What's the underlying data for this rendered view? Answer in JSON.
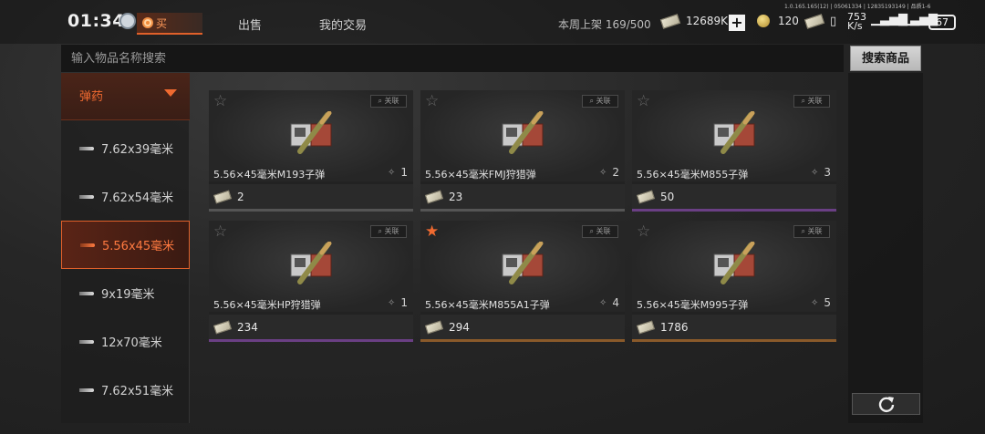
{
  "status": {
    "time": "01:34",
    "net_speed_top": "753",
    "net_speed_unit": "K/s",
    "battery": "67",
    "ip_line": "1.0.165.165(12) | 05061334 | 12835193149 | 品质1-6"
  },
  "tabs": {
    "buy": "买",
    "sell": "出售",
    "my_trades": "我的交易"
  },
  "header": {
    "weekly_label": "本周上架",
    "weekly_count": "169/500",
    "currency_money": "12689K",
    "currency_coin": "120"
  },
  "search": {
    "placeholder": "输入物品名称搜索",
    "button_label": "搜索商品"
  },
  "sidebar": {
    "category": "弹药",
    "items": [
      {
        "label": "7.62x39毫米"
      },
      {
        "label": "7.62x54毫米"
      },
      {
        "label": "5.56x45毫米"
      },
      {
        "label": "9x19毫米"
      },
      {
        "label": "12x70毫米"
      },
      {
        "label": "7.62x51毫米"
      }
    ]
  },
  "cards": [
    {
      "name": "5.56×45毫米M193子弹",
      "rank": "1",
      "price": "2",
      "assoc": "关联",
      "favorite": false,
      "tier_color": "#555555"
    },
    {
      "name": "5.56×45毫米FMJ狩猎弹",
      "rank": "2",
      "price": "23",
      "assoc": "关联",
      "favorite": false,
      "tier_color": "#555555"
    },
    {
      "name": "5.56×45毫米M855子弹",
      "rank": "3",
      "price": "50",
      "assoc": "关联",
      "favorite": false,
      "tier_color": "#6a3f84"
    },
    {
      "name": "5.56×45毫米HP狩猎弹",
      "rank": "1",
      "price": "234",
      "assoc": "关联",
      "favorite": false,
      "tier_color": "#6a3f84"
    },
    {
      "name": "5.56×45毫米M855A1子弹",
      "rank": "4",
      "price": "294",
      "assoc": "关联",
      "favorite": true,
      "tier_color": "#8a5a2a"
    },
    {
      "name": "5.56×45毫米M995子弹",
      "rank": "5",
      "price": "1786",
      "assoc": "关联",
      "favorite": false,
      "tier_color": "#8a5a2a"
    }
  ],
  "colors": {
    "accent": "#f06a30"
  }
}
